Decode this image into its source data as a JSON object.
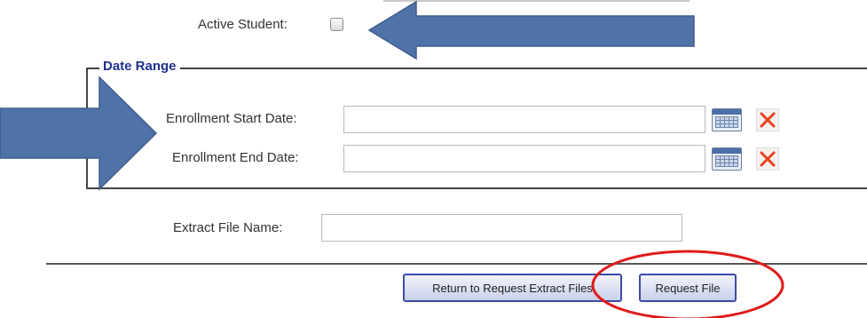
{
  "active_student": {
    "label": "Active Student:",
    "checked": false
  },
  "date_range": {
    "legend": "Date Range",
    "start": {
      "label": "Enrollment Start Date:",
      "value": "",
      "calendar_icon": "calendar-icon",
      "clear_icon": "clear-x-icon"
    },
    "end": {
      "label": "Enrollment End Date:",
      "value": "",
      "calendar_icon": "calendar-icon",
      "clear_icon": "clear-x-icon"
    }
  },
  "extract_file": {
    "label": "Extract File Name:",
    "value": ""
  },
  "buttons": {
    "return_label": "Return to Request Extract Files",
    "request_label": "Request File"
  },
  "annotations": {
    "arrow_color": "#4f73a8",
    "circle_color": "#e01b1b"
  },
  "colors": {
    "legend_text": "#1f2f8f",
    "button_border": "#3d4aa8",
    "clear_x": "#e8411c"
  }
}
